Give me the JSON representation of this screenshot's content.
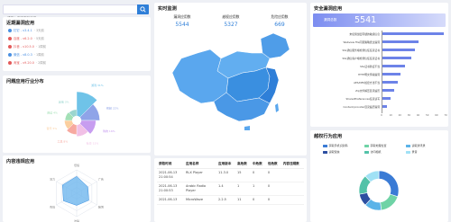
{
  "search": {
    "placeholder": "请输入内容查找应用"
  },
  "recent": {
    "title": "近期漏洞应用",
    "items": [
      {
        "name": "钉钉 - v3.4.1",
        "meta": "· 3天前",
        "color": "#4a90e2"
      },
      {
        "name": "百度 - v6.2.0",
        "meta": "· 5天前",
        "color": "#e35a5a"
      },
      {
        "name": "抖音 - v10.5.0",
        "meta": "· 1周前",
        "color": "#e35a5a"
      },
      {
        "name": "微信 - v8.0.3",
        "meta": "· 1周前",
        "color": "#4a90e2"
      },
      {
        "name": "淘宝 - v9.20.0",
        "meta": "· 2周前",
        "color": "#e35a5a"
      }
    ]
  },
  "industry": {
    "title": "问题应用行业分布",
    "slices": [
      {
        "label": "游戏 31%",
        "value": 31,
        "color": "#6fc3e8"
      },
      {
        "label": "视频 22%",
        "value": 22,
        "color": "#8fa4e8"
      },
      {
        "label": "购物 16%",
        "value": 16,
        "color": "#c79df0"
      },
      {
        "label": "社交 11%",
        "value": 11,
        "color": "#f1c0e6"
      },
      {
        "label": "工具 8%",
        "value": 8,
        "color": "#f7a9a0"
      },
      {
        "label": "音乐 5%",
        "value": 5,
        "color": "#fbcf9f"
      },
      {
        "label": "阅读 4%",
        "value": 4,
        "color": "#a3e0b6"
      },
      {
        "label": "其他 3%",
        "value": 3,
        "color": "#9bd6cf"
      }
    ]
  },
  "content": {
    "title": "内容违规应用",
    "axes": [
      "低俗",
      "广告",
      "赌博",
      "诈骗",
      "色情",
      "暴力"
    ],
    "values": [
      0.72,
      0.55,
      0.6,
      0.52,
      0.65,
      0.7
    ]
  },
  "realtime": {
    "title": "实时监测",
    "kpis": [
      {
        "label": "漏洞应用数",
        "value": "5544"
      },
      {
        "label": "越权应用数",
        "value": "5327"
      },
      {
        "label": "危险应用数",
        "value": "669"
      }
    ]
  },
  "table": {
    "headers": [
      "获取时间",
      "应用名称",
      "应用版本",
      "高危数",
      "中危数",
      "低危数",
      "内容违规数"
    ],
    "rows": [
      [
        "2021-06-13 21:00:54",
        "RLX Player",
        "11.3.0",
        "15",
        "0",
        "0",
        ""
      ],
      [
        "2021-06-13 21:00:53",
        "Arabic Radio Player",
        "1.4",
        "1",
        "1",
        "0",
        ""
      ],
      [
        "2021-06-13",
        "MicroWave",
        "2.2.5",
        "11",
        "0",
        "0",
        ""
      ]
    ]
  },
  "security": {
    "title": "安全漏洞应用",
    "banner_label": "漏洞总数",
    "banner_value": "5541",
    "bars": [
      {
        "label": "未使用加密存储的敏感信息",
        "value": 68
      },
      {
        "label": "Webview File同源策略绕过漏洞",
        "value": 40
      },
      {
        "label": "SSL通信服务端检测信任任意证书",
        "value": 36
      },
      {
        "label": "SSL通信客户端检测信任任意证书",
        "value": 33
      },
      {
        "label": "SSL证书验证不当",
        "value": 26
      },
      {
        "label": "HTTP明文传输漏洞",
        "value": 21
      },
      {
        "label": "AES/DES加密方法不当",
        "value": 18
      },
      {
        "label": "Zip文件解压目录遍历",
        "value": 14
      },
      {
        "label": "SharedPreferences任意读写",
        "value": 10
      },
      {
        "label": "Content provider目录遍历漏洞",
        "value": 6
      }
    ],
    "xticks": [
      "0",
      "10",
      "20",
      "30",
      "40",
      "50",
      "60",
      "70"
    ],
    "xmax": 70
  },
  "behavior": {
    "title": "越权行为应用",
    "legend": [
      {
        "label": "获取手机识别码",
        "color": "#3a7bd5"
      },
      {
        "label": "获取地理位置",
        "color": "#6fd3a6"
      },
      {
        "label": "读取通讯录",
        "color": "#5bb3e8"
      },
      {
        "label": "读取短信",
        "color": "#2d4fa1"
      },
      {
        "label": "访问相机",
        "color": "#53c2a8"
      },
      {
        "label": "录音",
        "color": "#a0e1f5"
      }
    ],
    "values": [
      30,
      18,
      14,
      10,
      16,
      12
    ]
  },
  "map": {
    "region_color": "#5aa7ee"
  }
}
